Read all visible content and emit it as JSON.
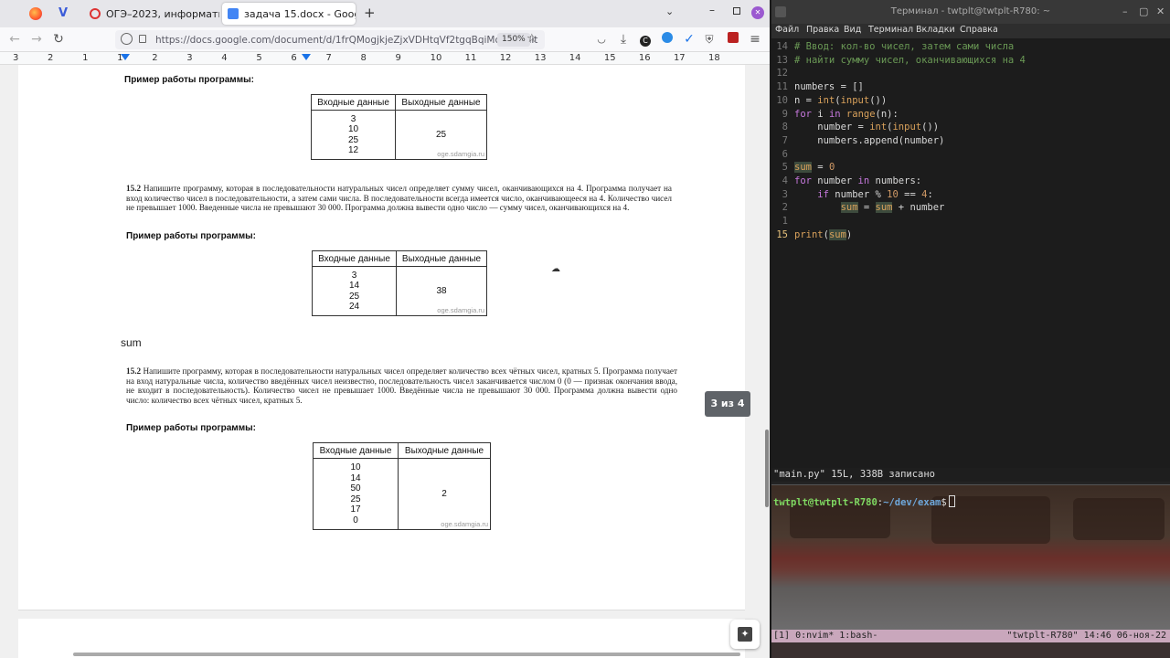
{
  "browser": {
    "tabs": [
      {
        "label": "ОГЭ–2023, информатика:",
        "active": false
      },
      {
        "label": "задача 15.docx - Google Д",
        "active": true
      }
    ],
    "new_tab": "+",
    "url": "https://docs.google.com/document/d/1frQMogjkjeZjxVDHtqVf2tgqBqiMct6h/edit",
    "zoom": "150%",
    "ruler_marks": [
      "3",
      "2",
      "1",
      "1",
      "2",
      "3",
      "4",
      "5",
      "6",
      "7",
      "8",
      "9",
      "10",
      "11",
      "12",
      "13",
      "14",
      "15",
      "16",
      "17",
      "18"
    ]
  },
  "doc": {
    "example_heading": "Пример работы программы:",
    "table_headers": [
      "Входные данные",
      "Выходные данные"
    ],
    "watermark": "oge.sdamgia.ru",
    "table1": {
      "inputs": [
        "3",
        "10",
        "25",
        "12"
      ],
      "output": "25"
    },
    "task2": {
      "number": "15.2",
      "text": "Напишите программу, которая в последовательности натуральных чисел определяет сумму чисел, оканчивающихся на 4. Программа получает на вход количество чисел в последовательности, а затем сами числа. В последовательности всегда имеется число, оканчивающееся на 4. Количество чисел не превышает 1000. Введенные числа не превышают 30 000. Программа должна вывести одно число — сумму чисел, оканчивающихся на 4."
    },
    "table2": {
      "inputs": [
        "3",
        "14",
        "25",
        "24"
      ],
      "output": "38"
    },
    "typed_word": "sum",
    "task3": {
      "number": "15.2",
      "text": "Напишите программу, которая в последовательности натуральных чисел определяет количество всех чётных чисел, кратных 5. Программа получает на вход натуральные числа, количество введённых чисел неизвестно, последовательность чисел заканчивается числом 0 (0 — признак окончания ввода, не входит в последовательность). Количество чисел не превышает 1000. Введённые числа не превышают 30 000. Программа должна вывести одно число: количество всех чётных чисел, кратных 5."
    },
    "table3": {
      "inputs": [
        "10",
        "14",
        "50",
        "25",
        "17",
        "0"
      ],
      "output": "2"
    },
    "page_indicator": "3 из 4"
  },
  "terminal": {
    "title": "Терминал - twtplt@twtplt-R780: ~",
    "menu": [
      "Файл",
      "Правка",
      "Вид",
      "Терминал",
      "Вкладки",
      "Справка"
    ],
    "line_numbers": [
      "14",
      "13",
      "12",
      "11",
      "10",
      "9",
      "8",
      "7",
      "6",
      "5",
      "4",
      "3",
      "2",
      "1",
      "15"
    ],
    "code": {
      "c1": "# Ввод: кол-во чисел, затем сами числа",
      "c2": "# найти сумму чисел, оканчивающихся на 4",
      "l4": "numbers = []",
      "l5a": "n = ",
      "l5b": "int",
      "l5c": "(",
      "l5d": "input",
      "l5e": "())",
      "l6a": "for",
      "l6b": " i ",
      "l6c": "in",
      "l6d": " ",
      "l6e": "range",
      "l6f": "(n):",
      "l7a": "    number = ",
      "l7b": "int",
      "l7c": "(",
      "l7d": "input",
      "l7e": "())",
      "l8": "    numbers.append(number)",
      "l10a": "sum",
      "l10b": " = ",
      "l10c": "0",
      "l11a": "for",
      "l11b": " number ",
      "l11c": "in",
      "l11d": " numbers:",
      "l12a": "    ",
      "l12b": "if",
      "l12c": " number % ",
      "l12d": "10",
      "l12e": " == ",
      "l12f": "4",
      "l12g": ":",
      "l13a": "        ",
      "l13b": "sum",
      "l13c": " = ",
      "l13d": "sum",
      "l13e": " + number",
      "l15a": "print",
      "l15b": "(",
      "l15c": "sum",
      "l15d": ")"
    },
    "status": "\"main.py\" 15L, 338B записано",
    "prompt_user": "twtplt@twtplt-R780",
    "prompt_colon": ":",
    "prompt_path": "~/dev/exam",
    "prompt_sign": "$",
    "tmux_left": "[1] 0:nvim* 1:bash-",
    "tmux_right": "\"twtplt-R780\" 14:46 06-ноя-22"
  }
}
